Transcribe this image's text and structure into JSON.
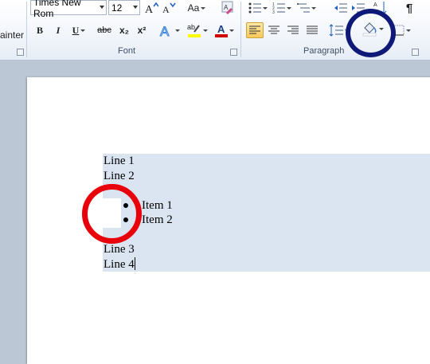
{
  "ribbon": {
    "clipboard": {
      "format_painter_label": "ainter"
    },
    "font": {
      "group_label": "Font",
      "font_name": "Times New Rom",
      "font_size": "12",
      "bold": "B",
      "italic": "I",
      "underline": "U",
      "strikethrough": "abc",
      "subscript": "x₂",
      "superscript": "x²",
      "change_case": "Aa",
      "highlight_label": "ab",
      "font_color_label": "A"
    },
    "paragraph": {
      "group_label": "Paragraph",
      "show_marks": "¶"
    }
  },
  "document": {
    "lines": [
      "Line 1",
      "Line 2",
      "",
      "Item 1",
      "Item 2",
      "",
      "Line 3",
      "Line 4"
    ]
  },
  "annotations": {
    "red_circle_color": "#e8000b",
    "blue_circle_color": "#0f1a78"
  },
  "colors": {
    "highlight_yellow": "#ffff00",
    "font_red": "#d00000",
    "selection": "#dbe4f1"
  }
}
